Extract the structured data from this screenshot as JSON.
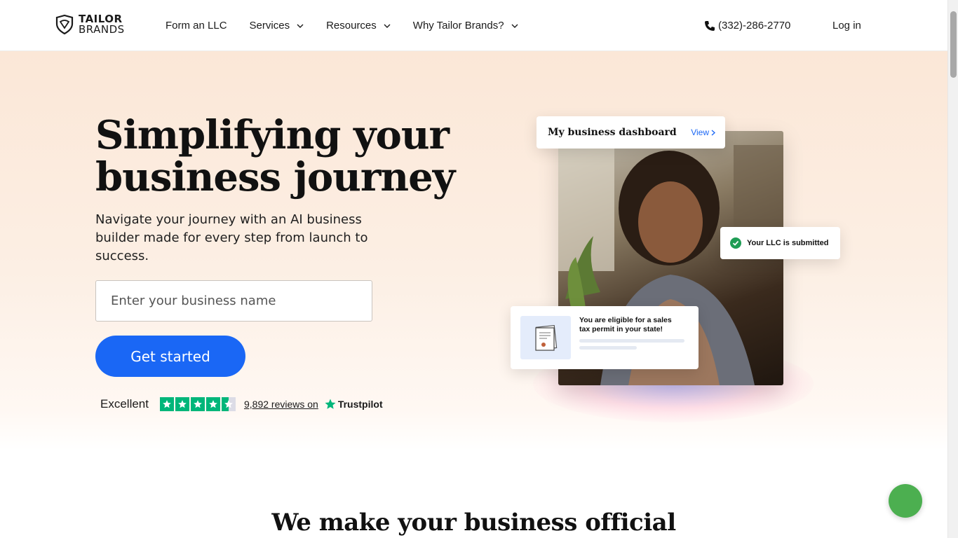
{
  "header": {
    "logo_line1": "TAILOR",
    "logo_line2": "BRANDS",
    "nav": [
      {
        "label": "Form an LLC"
      },
      {
        "label": "Services"
      },
      {
        "label": "Resources"
      },
      {
        "label": "Why Tailor Brands?"
      }
    ],
    "phone": "(332)-286-2770",
    "login": "Log in"
  },
  "hero": {
    "title": "Simplifying your business journey",
    "subtitle": "Navigate your journey with an AI business builder made for every step from launch to success.",
    "input_placeholder": "Enter your business name",
    "cta": "Get started",
    "trust_word": "Excellent",
    "reviews": "9,892 reviews on",
    "trustpilot": "Trustpilot",
    "rating_stars": 4.5
  },
  "illustration": {
    "dashboard_title": "My business dashboard",
    "dashboard_view": "View",
    "llc_status": "Your LLC is submitted",
    "tax_text": "You are eligible for a sales tax permit in your state!"
  },
  "section": {
    "title": "We make your business official"
  },
  "colors": {
    "accent": "#1a67f5",
    "trustpilot_green": "#00b67a",
    "chat_green": "#4caf50"
  }
}
